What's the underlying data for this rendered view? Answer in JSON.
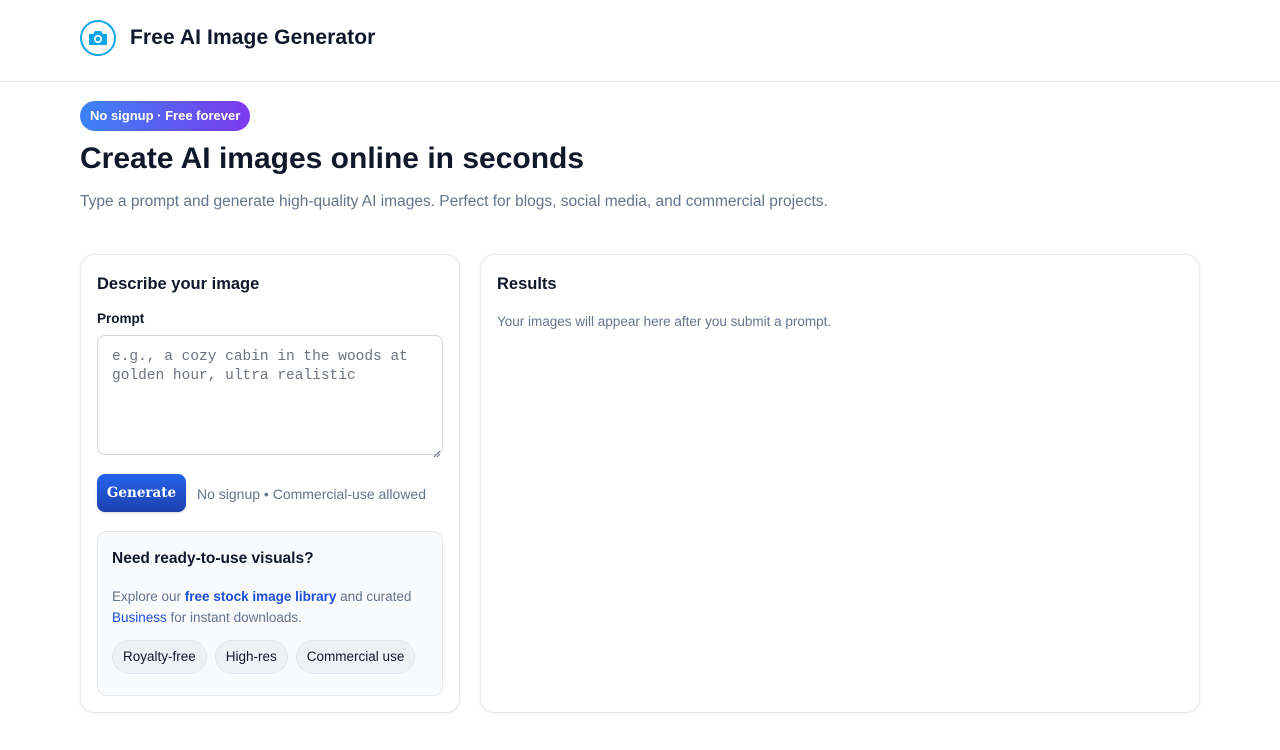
{
  "header": {
    "brand_name": "Free AI Image Generator",
    "logo_icon": "camera-icon"
  },
  "hero": {
    "badge": "No signup · Free forever",
    "title": "Create AI images online in seconds",
    "subtitle": "Type a prompt and generate high-quality AI images. Perfect for blogs, social media, and commercial projects."
  },
  "form": {
    "title": "Describe your image",
    "prompt_label": "Prompt",
    "prompt_placeholder": "e.g., a cozy cabin in the woods at golden hour, ultra realistic",
    "prompt_value": "",
    "generate_label": "Generate",
    "generate_note": "No signup • Commercial-use allowed"
  },
  "promo": {
    "title": "Need ready-to-use visuals?",
    "text_prefix": "Explore our ",
    "link_library": "free stock image library",
    "text_middle": " and curated ",
    "link_business": "Business",
    "text_suffix": " for instant downloads.",
    "chips": [
      "Royalty-free",
      "High-res",
      "Commercial use"
    ]
  },
  "results": {
    "title": "Results",
    "empty_text": "Your images will appear here after you submit a prompt."
  },
  "colors": {
    "accent": "#2563eb",
    "accent_dark": "#1e40af",
    "badge_gradient_start": "#3b82f6",
    "badge_gradient_end": "#7c3aed",
    "logo": "#0ea5e9",
    "text_muted": "#64748b"
  }
}
